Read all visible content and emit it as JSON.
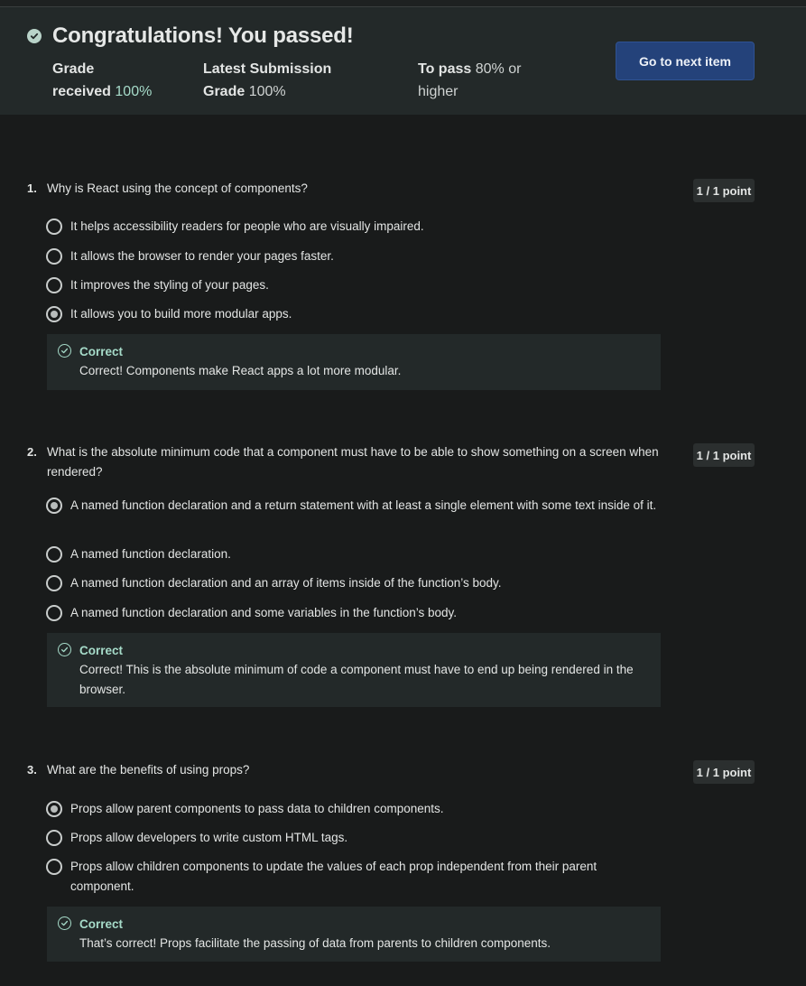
{
  "banner": {
    "title": "Congratulations! You passed!",
    "grade": {
      "label_line1": "Grade",
      "label_line2": "received",
      "value": "100%"
    },
    "latest": {
      "label_line1": "Latest Submission",
      "label_line2": "Grade",
      "value": "100%"
    },
    "to_pass": {
      "label": "To pass",
      "value_line1": "80% or",
      "value_line2": "higher"
    },
    "next_button": "Go to next item",
    "icon": "check-circle-icon"
  },
  "questions": [
    {
      "number": "1.",
      "text": "Why is React using the concept of components?",
      "points": "1 / 1 point",
      "options": [
        {
          "text": "It helps accessibility readers for people who are visually impaired.",
          "selected": false
        },
        {
          "text": "It allows the browser to render your pages faster.",
          "selected": false
        },
        {
          "text": "It improves the styling of your pages.",
          "selected": false
        },
        {
          "text": "It allows you to build more modular apps.",
          "selected": true
        }
      ],
      "feedback": {
        "title": "Correct",
        "text": "Correct! Components make React apps a lot more modular."
      }
    },
    {
      "number": "2.",
      "text": "What is the absolute minimum code that a component must have to be able to show something on a screen when rendered?",
      "points": "1 / 1 point",
      "options": [
        {
          "text": "A named function declaration and a return statement with at least a single element with some text inside of it.",
          "selected": true
        },
        {
          "text": "A named function declaration.",
          "selected": false
        },
        {
          "text": "A named function declaration and an array of items inside of the function’s body.",
          "selected": false
        },
        {
          "text": "A named function declaration and some variables in the function’s body.",
          "selected": false
        }
      ],
      "feedback": {
        "title": "Correct",
        "text": "Correct! This is the absolute minimum of code a component must have to end up being rendered in the browser."
      }
    },
    {
      "number": "3.",
      "text": "What are the benefits of using props?",
      "points": "1 / 1 point",
      "options": [
        {
          "text": "Props allow parent components to pass data to children components.",
          "selected": true
        },
        {
          "text": "Props allow developers to write custom HTML tags.",
          "selected": false
        },
        {
          "text": "Props allow children components to update the values of each prop independent from their parent component.",
          "selected": false
        }
      ],
      "feedback": {
        "title": "Correct",
        "text": "That’s correct! Props facilitate the passing of data from parents to children components."
      }
    }
  ],
  "colors": {
    "background": "#191b1b",
    "banner": "#232929",
    "accent_green": "#a6dbc9",
    "button": "#24427a"
  }
}
